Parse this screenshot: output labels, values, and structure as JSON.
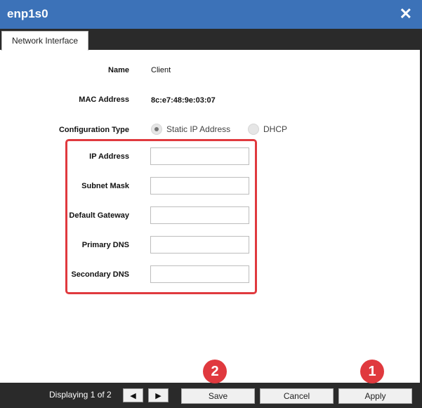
{
  "window": {
    "title": "enp1s0",
    "close_icon": "close-icon"
  },
  "tabs": [
    {
      "label": "Network Interface"
    }
  ],
  "info": {
    "name_label": "Name",
    "name_value": "Client",
    "mac_label": "MAC Address",
    "mac_value": "8c:e7:48:9e:03:07",
    "config_label": "Configuration Type",
    "static_label": "Static IP Address",
    "dhcp_label": "DHCP",
    "selected": "Static IP Address"
  },
  "fields": {
    "ip_label": "IP Address",
    "ip_value": "",
    "subnet_label": "Subnet Mask",
    "subnet_value": "",
    "gateway_label": "Default Gateway",
    "gateway_value": "",
    "dns1_label": "Primary DNS",
    "dns1_value": "",
    "dns2_label": "Secondary DNS",
    "dns2_value": ""
  },
  "footer": {
    "displaying": "Displaying 1 of 2",
    "prev_icon": "◀",
    "next_icon": "▶",
    "save_label": "Save",
    "cancel_label": "Cancel",
    "apply_label": "Apply"
  },
  "annotations": {
    "badge_save": "2",
    "badge_apply": "1"
  },
  "colors": {
    "titlebar": "#3c72b8",
    "footer": "#2a2a2a",
    "highlight": "#e0393e"
  }
}
